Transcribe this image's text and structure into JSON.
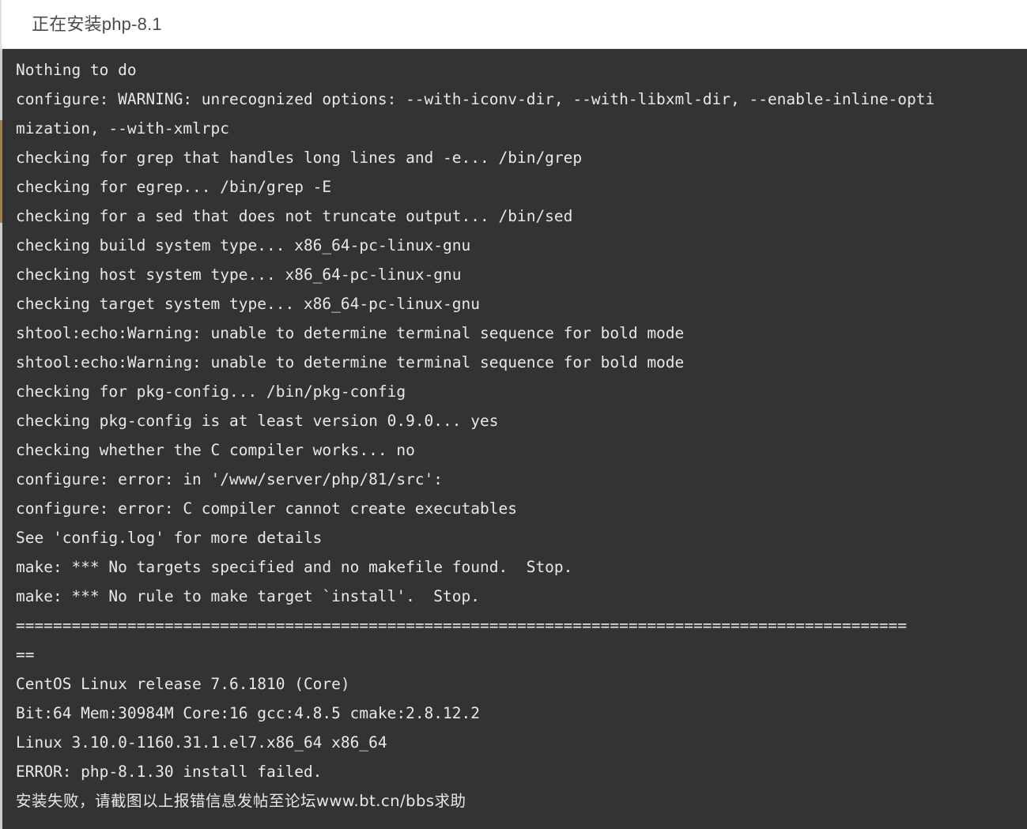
{
  "window": {
    "title": "正在安装php-8.1",
    "background_color": "#ffffff",
    "terminal_background_color": "#333333",
    "terminal_text_color": "#e8e8e8"
  },
  "scrollbar": {
    "position": "left",
    "track_color": "#c9ccd1",
    "thumb_color": "#9c8354"
  },
  "terminal": {
    "lines": [
      {
        "id": "l01",
        "text": "Nothing to do"
      },
      {
        "id": "l02",
        "text": "configure: WARNING: unrecognized options: --with-iconv-dir, --with-libxml-dir, --enable-inline-opti"
      },
      {
        "id": "l03",
        "text": "mization, --with-xmlrpc"
      },
      {
        "id": "l04",
        "text": "checking for grep that handles long lines and -e... /bin/grep"
      },
      {
        "id": "l05",
        "text": "checking for egrep... /bin/grep -E"
      },
      {
        "id": "l06",
        "text": "checking for a sed that does not truncate output... /bin/sed"
      },
      {
        "id": "l07",
        "text": "checking build system type... x86_64-pc-linux-gnu"
      },
      {
        "id": "l08",
        "text": "checking host system type... x86_64-pc-linux-gnu"
      },
      {
        "id": "l09",
        "text": "checking target system type... x86_64-pc-linux-gnu"
      },
      {
        "id": "l10",
        "text": "shtool:echo:Warning: unable to determine terminal sequence for bold mode"
      },
      {
        "id": "l11",
        "text": "shtool:echo:Warning: unable to determine terminal sequence for bold mode"
      },
      {
        "id": "l12",
        "text": "checking for pkg-config... /bin/pkg-config"
      },
      {
        "id": "l13",
        "text": "checking pkg-config is at least version 0.9.0... yes"
      },
      {
        "id": "l14",
        "text": "checking whether the C compiler works... no"
      },
      {
        "id": "l15",
        "text": "configure: error: in '/www/server/php/81/src':"
      },
      {
        "id": "l16",
        "text": "configure: error: C compiler cannot create executables"
      },
      {
        "id": "l17",
        "text": "See 'config.log' for more details"
      },
      {
        "id": "l18",
        "text": "make: *** No targets specified and no makefile found.  Stop."
      },
      {
        "id": "l19",
        "text": "make: *** No rule to make target `install'.  Stop."
      },
      {
        "id": "l20",
        "text": "================================================================================================"
      },
      {
        "id": "l21",
        "text": "=="
      },
      {
        "id": "l22",
        "text": "CentOS Linux release 7.6.1810 (Core)"
      },
      {
        "id": "l23",
        "text": "Bit:64 Mem:30984M Core:16 gcc:4.8.5 cmake:2.8.12.2"
      },
      {
        "id": "l24",
        "text": "Linux 3.10.0-1160.31.1.el7.x86_64 x86_64"
      },
      {
        "id": "l25",
        "text": "ERROR: php-8.1.30 install failed."
      },
      {
        "id": "l26",
        "text": "安装失败，请截图以上报错信息发帖至论坛www.bt.cn/bbs求助"
      }
    ]
  }
}
